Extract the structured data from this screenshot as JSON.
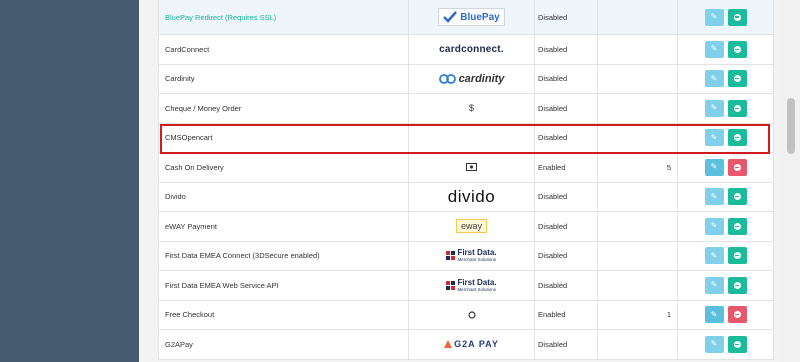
{
  "colors": {
    "sidebar": "#465b6f",
    "highlight": "#d01c1c",
    "edit": "#5bc0de",
    "install": "#1abc9c",
    "uninstall": "#e8586c"
  },
  "rows": [
    {
      "name": "BluePay Redirect (Requires SSL)",
      "logo": "bluepay",
      "logo_text": "BluePay",
      "status": "Disabled",
      "sort": "",
      "installed": false
    },
    {
      "name": "CardConnect",
      "logo": "cardconnect",
      "logo_text": "cardconnect.",
      "status": "Disabled",
      "sort": "",
      "installed": false
    },
    {
      "name": "Cardinity",
      "logo": "cardinity",
      "logo_text": "cardinity",
      "status": "Disabled",
      "sort": "",
      "installed": false
    },
    {
      "name": "Cheque / Money Order",
      "logo": "dollar-icon",
      "logo_text": "$",
      "status": "Disabled",
      "sort": "",
      "installed": false
    },
    {
      "name": "CMSOpencart",
      "logo": "",
      "logo_text": "",
      "status": "Disabled",
      "sort": "",
      "installed": false
    },
    {
      "name": "Cash On Delivery",
      "logo": "money-icon",
      "logo_text": "",
      "status": "Enabled",
      "sort": "5",
      "installed": true
    },
    {
      "name": "Divido",
      "logo": "divido",
      "logo_text": "divido",
      "status": "Disabled",
      "sort": "",
      "installed": false
    },
    {
      "name": "eWAY Payment",
      "logo": "eway",
      "logo_text": "eway",
      "status": "Disabled",
      "sort": "",
      "installed": false
    },
    {
      "name": "First Data EMEA Connect (3DSecure enabled)",
      "logo": "firstdata",
      "logo_text": "First Data.",
      "logo_sub": "Merchant Solutions",
      "status": "Disabled",
      "sort": "",
      "installed": false
    },
    {
      "name": "First Data EMEA Web Service API",
      "logo": "firstdata",
      "logo_text": "First Data.",
      "logo_sub": "Merchant Solutions",
      "status": "Disabled",
      "sort": "",
      "installed": false
    },
    {
      "name": "Free Checkout",
      "logo": "circle-icon",
      "logo_text": "",
      "status": "Enabled",
      "sort": "1",
      "installed": true
    },
    {
      "name": "G2APay",
      "logo": "g2apay",
      "logo_text": "G2A PAY",
      "status": "Disabled",
      "sort": "",
      "installed": false
    }
  ]
}
